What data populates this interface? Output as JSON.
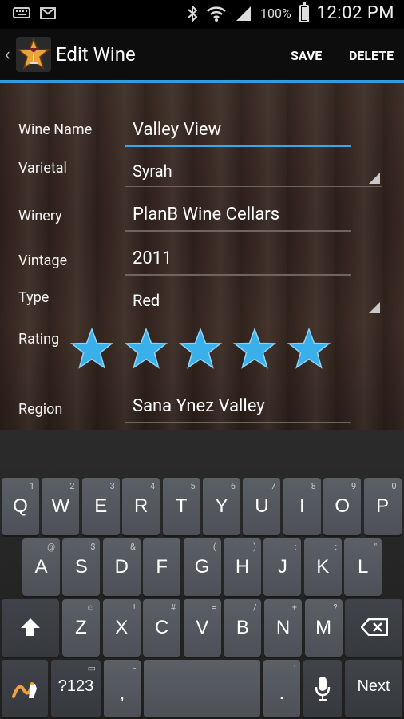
{
  "status_bar": {
    "battery": "100%",
    "time": "12:02 PM"
  },
  "action_bar": {
    "title": "Edit Wine",
    "save_label": "SAVE",
    "delete_label": "DELETE",
    "accent": "#2f9ee0"
  },
  "form": {
    "wine_name_label": "Wine Name",
    "wine_name_value": "Valley View",
    "varietal_label": "Varietal",
    "varietal_value": "Syrah",
    "winery_label": "Winery",
    "winery_value": "PlanB Wine Cellars",
    "vintage_label": "Vintage",
    "vintage_value": "2011",
    "type_label": "Type",
    "type_value": "Red",
    "rating_label": "Rating",
    "rating_value": 5,
    "rating_max": 5,
    "star_color": "#3ab0ea",
    "region_label": "Region",
    "region_value": "Sana Ynez Valley"
  },
  "keyboard": {
    "row1": [
      {
        "main": "Q",
        "sub": "1"
      },
      {
        "main": "W",
        "sub": "2"
      },
      {
        "main": "E",
        "sub": "3"
      },
      {
        "main": "R",
        "sub": "4"
      },
      {
        "main": "T",
        "sub": "5"
      },
      {
        "main": "Y",
        "sub": "6"
      },
      {
        "main": "U",
        "sub": "7"
      },
      {
        "main": "I",
        "sub": "8"
      },
      {
        "main": "O",
        "sub": "9"
      },
      {
        "main": "P",
        "sub": "0"
      }
    ],
    "row2": [
      {
        "main": "A",
        "sub": "@"
      },
      {
        "main": "S",
        "sub": "$"
      },
      {
        "main": "D",
        "sub": "&"
      },
      {
        "main": "F",
        "sub": "_"
      },
      {
        "main": "G",
        "sub": "("
      },
      {
        "main": "H",
        "sub": ")"
      },
      {
        "main": "J",
        "sub": ":"
      },
      {
        "main": "K",
        "sub": ";"
      },
      {
        "main": "L",
        "sub": "\""
      }
    ],
    "row3": [
      {
        "main": "Z",
        "sub": "☺"
      },
      {
        "main": "X",
        "sub": "!"
      },
      {
        "main": "C",
        "sub": "#"
      },
      {
        "main": "V",
        "sub": "="
      },
      {
        "main": "B",
        "sub": "/"
      },
      {
        "main": "N",
        "sub": "+"
      },
      {
        "main": "M",
        "sub": "?"
      }
    ],
    "symbols_label": "?123",
    "comma_label": ",",
    "period_label": ".",
    "next_label": "Next"
  }
}
